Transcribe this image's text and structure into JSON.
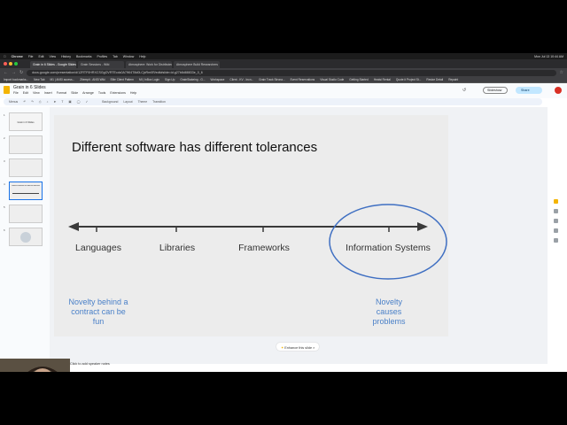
{
  "mac_menubar": {
    "items": [
      "Chrome",
      "File",
      "Edit",
      "View",
      "History",
      "Bookmarks",
      "Profiles",
      "Tab",
      "Window",
      "Help"
    ],
    "clock": "Mon Jul 13 10:44 AM"
  },
  "browser": {
    "tabs": [
      {
        "label": "Grain in 6 Slides - Google Slides",
        "active": true
      },
      {
        "label": "Grain Sessions - Wiki",
        "active": false
      },
      {
        "label": "Atmosphere: Work for Distributed",
        "active": false
      },
      {
        "label": "Atmosphere Build Researchers",
        "active": false
      }
    ],
    "url": "docs.google.com/presentation/d/1ZRTF0HRXCSGgOVRTEcdc0A7Wl4T8d0LCjxRm0R/edit#slide=id.g27b8d88833e_0_6",
    "bookmarks": [
      "Import bookmarks...",
      "New Tab",
      "M1 | ANSI access...",
      "Zitempit - ANSI Wiki",
      "Elite Client Pattern",
      "MI | InBox Login",
      "Sign Up",
      "GrainStakeing - G...",
      "Workspace",
      "Client - KV - Incn...",
      "Grain Track Strona...",
      "Event Reservations",
      "Visual Studio Code",
      "Getting Started",
      "Heatsi Rental",
      "Quote it Project St...",
      "Resize Detail",
      "Repaint"
    ]
  },
  "app": {
    "doc_title": "Grain in 6 Slides",
    "menu": [
      "File",
      "Edit",
      "View",
      "Insert",
      "Format",
      "Slide",
      "Arrange",
      "Tools",
      "Extensions",
      "Help"
    ],
    "slideshow_label": "Slideshow",
    "share_label": "Share",
    "toolbar": [
      "Menus",
      "Background",
      "Layout",
      "Theme",
      "Transition"
    ]
  },
  "thumbnails": [
    {
      "num": "1",
      "title": "Grain in 6 Slides"
    },
    {
      "num": "2",
      "title": ""
    },
    {
      "num": "3",
      "title": ""
    },
    {
      "num": "4",
      "title": "Different software has different tolerances"
    },
    {
      "num": "5",
      "title": ""
    },
    {
      "num": "6",
      "title": ""
    }
  ],
  "slide": {
    "title": "Different software has different tolerances",
    "categories": [
      "Languages",
      "Libraries",
      "Frameworks",
      "Information Systems"
    ],
    "note_left": [
      "Novelty behind a",
      "contract can be",
      "fun"
    ],
    "note_right": [
      "Novelty",
      "causes",
      "problems"
    ],
    "circle_color": "#3f6fc2",
    "axis_color": "#3a3a3a",
    "note_color": "#4a80c8"
  },
  "enhance_label": "Enhance this slide",
  "speaker_notes_label": "Click to add speaker notes"
}
